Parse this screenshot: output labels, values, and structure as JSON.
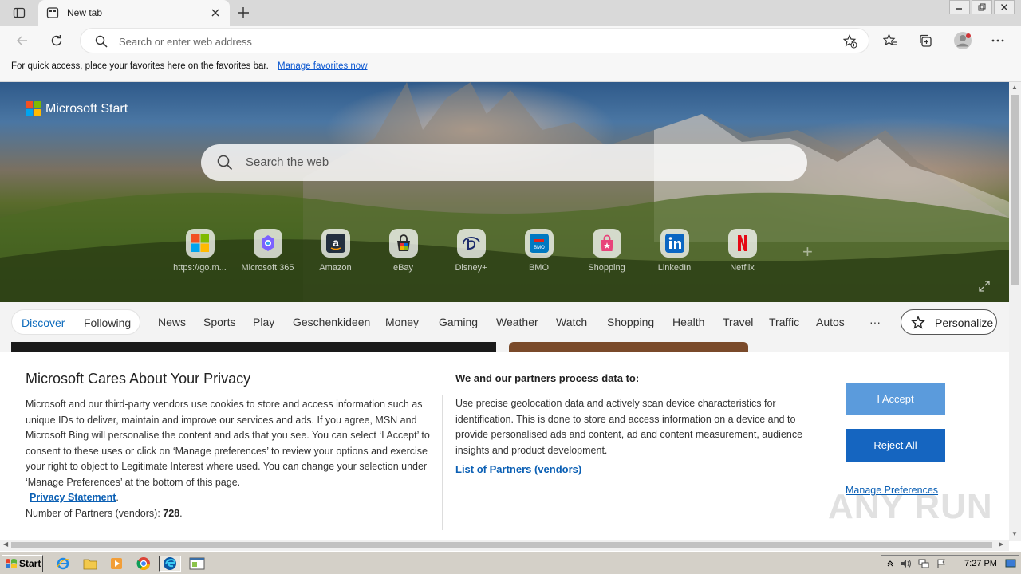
{
  "browser": {
    "tab_title": "New tab",
    "address_placeholder": "Search or enter web address"
  },
  "favorites_bar": {
    "message": "For quick access, place your favorites here on the favorites bar.",
    "link": "Manage favorites now"
  },
  "hero": {
    "brand": "Microsoft Start",
    "search_placeholder": "Search the web",
    "quick_links": [
      {
        "label": "https://go.m...",
        "icon": "windows-logo-icon"
      },
      {
        "label": "Microsoft 365",
        "icon": "m365-icon"
      },
      {
        "label": "Amazon",
        "icon": "amazon-icon"
      },
      {
        "label": "eBay",
        "icon": "ebay-icon"
      },
      {
        "label": "Disney+",
        "icon": "disney-icon"
      },
      {
        "label": "BMO",
        "icon": "bmo-icon"
      },
      {
        "label": "Shopping",
        "icon": "shopping-bag-icon"
      },
      {
        "label": "LinkedIn",
        "icon": "linkedin-icon"
      },
      {
        "label": "Netflix",
        "icon": "netflix-icon"
      }
    ]
  },
  "feed_nav": {
    "discover": "Discover",
    "following": "Following",
    "items": [
      "News",
      "Sports",
      "Play",
      "Geschenkideen",
      "Money",
      "Gaming",
      "Weather",
      "Watch",
      "Shopping",
      "Health",
      "Travel",
      "Traffic",
      "Autos"
    ],
    "more": "···",
    "personalize": "Personalize"
  },
  "consent": {
    "title": "Microsoft Cares About Your Privacy",
    "body": "Microsoft and our third-party vendors use cookies to store and access information such as unique IDs to deliver, maintain and improve our services and ads. If you agree, MSN and Microsoft Bing will personalise the content and ads that you see. You can select ‘I Accept’ to consent to these uses or click on ‘Manage preferences’ to review your options and exercise your right to object to Legitimate Interest where used.  You can change your selection under ‘Manage Preferences’ at the bottom of this page.",
    "privacy_link": "Privacy Statement",
    "partners_count_label": "Number of Partners (vendors): ",
    "partners_count": "728",
    "subtitle": "We and our partners process data to:",
    "purposes": "Use precise geolocation data and actively scan device characteristics for identification. This is done to store and access information on a device and to provide personalised ads and content, ad and content measurement, audience insights and product development.",
    "partners_link": "List of Partners (vendors)",
    "accept": "I Accept",
    "reject": "Reject All",
    "manage": "Manage Preferences"
  },
  "watermark": "ANY RUN",
  "taskbar": {
    "start": "Start",
    "clock": "7:27 PM"
  },
  "colors": {
    "accent": "#0f6cbd",
    "accept_btn": "#5b9bdc",
    "reject_btn": "#1565c0"
  }
}
